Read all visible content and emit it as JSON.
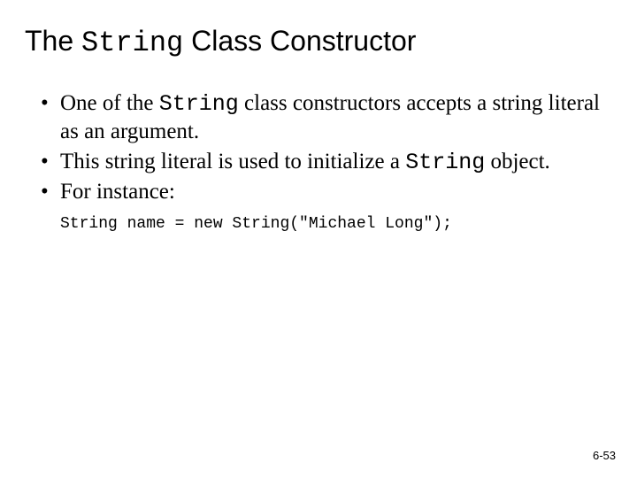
{
  "title": {
    "pre": "The ",
    "code": "String",
    "post": " Class Constructor"
  },
  "bullets": [
    {
      "pre": "One of the ",
      "code": "String",
      "post": " class constructors accepts a string literal as an argument."
    },
    {
      "pre": "This string literal is used to initialize a ",
      "code": "String",
      "post": " object."
    },
    {
      "pre": "For instance:",
      "code": "",
      "post": ""
    }
  ],
  "code_example": "String name = new String(\"Michael Long\");",
  "page_number": "6-53"
}
